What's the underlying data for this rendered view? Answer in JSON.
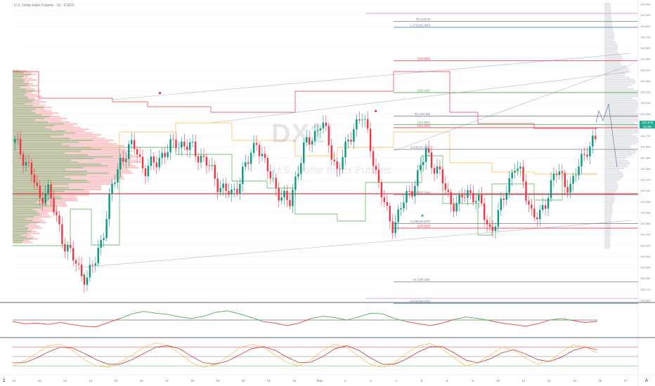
{
  "header": {
    "ticker": "U.S. Dollar Index Futures · 1h · ICEUS"
  },
  "watermark": {
    "symbol": "DX1!",
    "name": "U.S. Dollar Index Futures"
  },
  "price_badge": {
    "price": "101.675",
    "countdown": "51:25"
  },
  "corner_labels": {
    "left": "2",
    "right": "A"
  },
  "x_axis": {
    "ticks": [
      "11",
      "12",
      "13",
      "14",
      "15",
      "16",
      "17",
      "18",
      "19",
      "20",
      "21",
      "22",
      "May",
      "2",
      "3",
      "4",
      "5",
      "6",
      "9",
      "10",
      "11",
      "12",
      "13",
      "16",
      "17"
    ]
  },
  "colors": {
    "up": "#089981",
    "down": "#f23645",
    "rsi": "#4caf50",
    "rsi_low": "#f23645",
    "pivot_red": "#f23645",
    "pivot_green": "#4caf50",
    "fib_blue": "#5b7fa6",
    "fib_purple": "#ce93d8",
    "fib_orange": "#ffb74d",
    "channel": "#b2b5be"
  },
  "chart_data": [
    {
      "type": "candlestick",
      "title": "",
      "ylim": [
        100.1,
        103.1
      ],
      "y_ticks": [
        "103.030",
        "102.920",
        "102.810",
        "102.700",
        "102.590",
        "102.480",
        "102.370",
        "102.260",
        "102.150",
        "102.040",
        "101.930",
        "101.820",
        "101.710",
        "101.600",
        "101.490",
        "101.380",
        "101.270",
        "101.160",
        "101.050",
        "100.940",
        "100.830",
        "100.720",
        "100.610",
        "100.500",
        "100.390",
        "100.280",
        "100.170",
        "100.060"
      ],
      "close_path": [
        101.68,
        101.55,
        101.4,
        101.1,
        101.25,
        100.95,
        100.7,
        100.55,
        100.4,
        100.32,
        100.5,
        100.8,
        101.2,
        101.5,
        101.6,
        101.65,
        101.4,
        101.45,
        101.55,
        101.6,
        101.7,
        101.65,
        101.62,
        101.55,
        101.45,
        101.3,
        101.2,
        101.15,
        101.35,
        101.5,
        101.72,
        101.45,
        101.3,
        101.15,
        101.05,
        101.4,
        101.65,
        101.75,
        101.9,
        101.65,
        101.4,
        101.6,
        101.85,
        101.95,
        101.7,
        101.3,
        101.0,
        100.85,
        101.05,
        101.2,
        101.35,
        101.6,
        101.45,
        101.3,
        101.1,
        101.05,
        101.2,
        101.15,
        101.0,
        100.8,
        100.95,
        101.25,
        101.45,
        101.3,
        101.0,
        100.9,
        101.15,
        101.4,
        101.3,
        101.25,
        101.45,
        101.65,
        101.7
      ],
      "markers": [
        {
          "kind": "pivot_high",
          "x": 0.25,
          "y": 102.18
        },
        {
          "kind": "pivot_low",
          "x": 0.12,
          "y": 100.35
        },
        {
          "kind": "pivot_high",
          "x": 0.62,
          "y": 102.0
        },
        {
          "kind": "pivot_low",
          "x": 0.7,
          "y": 100.95
        }
      ],
      "fib_levels": [
        {
          "label": "R2 (102.9)",
          "value": 102.9,
          "color": "#787b86"
        },
        {
          "label": "1.272(102.840)",
          "value": 102.84,
          "color": "#5b7fa6"
        },
        {
          "label": "(102.505)",
          "value": 102.505,
          "color": "#f23645"
        },
        {
          "label": "(102.185)",
          "value": 102.185,
          "color": "#4caf50"
        },
        {
          "label": "R1 (101.95)",
          "value": 101.95,
          "color": "#787b86"
        },
        {
          "label": "(101.865)",
          "value": 101.865,
          "color": "#4caf50"
        },
        {
          "label": "(101.833)",
          "value": 101.833,
          "color": "#f23645"
        },
        {
          "label": "0.618(101.615)",
          "value": 101.615,
          "color": "#787b86"
        },
        {
          "label": "0.382(101.160)",
          "value": 101.16,
          "color": "#787b86"
        },
        {
          "label": "0.236(100.870)",
          "value": 100.87,
          "color": "#787b86"
        },
        {
          "label": "(100.825)",
          "value": 100.825,
          "color": "#f23645"
        },
        {
          "label": "S1 (100.285)",
          "value": 100.285,
          "color": "#787b86"
        },
        {
          "label": "-0.272(100.070)",
          "value": 100.07,
          "color": "#5b7fa6"
        }
      ]
    },
    {
      "type": "line",
      "title": "",
      "ylim": [
        0,
        100
      ],
      "series": [
        {
          "values": [
            45,
            38,
            40,
            36,
            42,
            35,
            30,
            28,
            42,
            55,
            70,
            78,
            72,
            68,
            60,
            55,
            62,
            75,
            80,
            70,
            58,
            45,
            40,
            32,
            40,
            55,
            62,
            58,
            50,
            60,
            72,
            70,
            55,
            45,
            38,
            32,
            40,
            52,
            60,
            55,
            48,
            40,
            35,
            30,
            38,
            50,
            55,
            48,
            42,
            46
          ]
        }
      ],
      "midline": 50
    },
    {
      "type": "line",
      "title": "",
      "ylim": [
        0,
        100
      ],
      "series": [
        {
          "values": [
            20,
            35,
            60,
            85,
            90,
            70,
            40,
            20,
            15,
            30,
            55,
            80,
            95,
            85,
            60,
            30,
            15,
            25,
            50,
            78,
            90,
            80,
            55,
            30,
            20,
            40,
            70,
            90,
            80,
            50,
            25,
            15,
            30,
            60,
            85,
            92,
            75,
            45,
            20,
            30,
            55,
            80,
            70,
            45,
            25,
            35,
            65,
            88,
            82,
            60
          ]
        },
        {
          "values": [
            30,
            30,
            45,
            65,
            80,
            78,
            60,
            40,
            25,
            25,
            40,
            60,
            80,
            85,
            75,
            50,
            30,
            25,
            35,
            55,
            75,
            82,
            70,
            48,
            30,
            32,
            50,
            75,
            85,
            70,
            45,
            25,
            25,
            42,
            65,
            82,
            82,
            62,
            38,
            30,
            42,
            62,
            72,
            58,
            40,
            34,
            48,
            70,
            80,
            72
          ]
        }
      ],
      "levels": [
        80,
        50,
        20
      ]
    }
  ]
}
